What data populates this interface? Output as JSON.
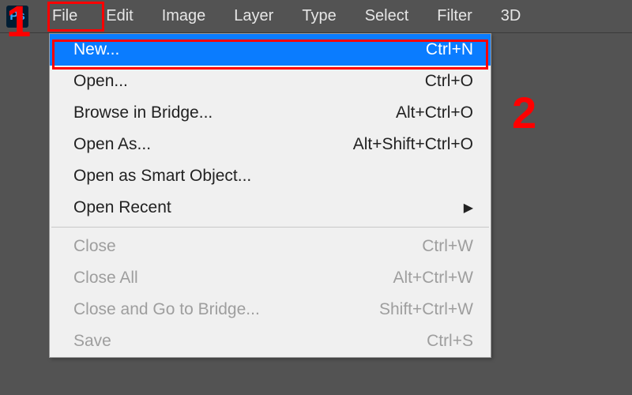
{
  "app": {
    "icon_text": "Ps"
  },
  "menubar": {
    "items": [
      "File",
      "Edit",
      "Image",
      "Layer",
      "Type",
      "Select",
      "Filter",
      "3D"
    ]
  },
  "dropdown": {
    "items": [
      {
        "label": "New...",
        "shortcut": "Ctrl+N",
        "selected": true
      },
      {
        "label": "Open...",
        "shortcut": "Ctrl+O"
      },
      {
        "label": "Browse in Bridge...",
        "shortcut": "Alt+Ctrl+O"
      },
      {
        "label": "Open As...",
        "shortcut": "Alt+Shift+Ctrl+O"
      },
      {
        "label": "Open as Smart Object...",
        "shortcut": ""
      },
      {
        "label": "Open Recent",
        "shortcut": "",
        "submenu": true
      }
    ],
    "items2": [
      {
        "label": "Close",
        "shortcut": "Ctrl+W",
        "disabled": true
      },
      {
        "label": "Close All",
        "shortcut": "Alt+Ctrl+W",
        "disabled": true
      },
      {
        "label": "Close and Go to Bridge...",
        "shortcut": "Shift+Ctrl+W",
        "disabled": true
      },
      {
        "label": "Save",
        "shortcut": "Ctrl+S",
        "disabled": true
      }
    ]
  },
  "annotations": {
    "one": "1",
    "two": "2"
  }
}
